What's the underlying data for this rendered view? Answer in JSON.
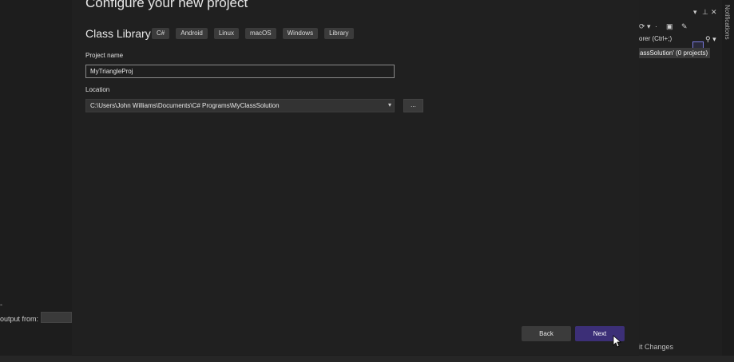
{
  "left_pane": {
    "tick": "-",
    "output_from_label": "output from:"
  },
  "dialog": {
    "title": "Configure your new project",
    "template_name": "Class Library",
    "tags": [
      "C#",
      "Android",
      "Linux",
      "macOS",
      "Windows",
      "Library"
    ],
    "project_name_label": "Project name",
    "project_name_value": "MyTriangleProj",
    "location_label": "Location",
    "location_value": "C:\\Users\\John Williams\\Documents\\C# Programs\\MyClassSolution",
    "browse_label": "...",
    "back_label": "Back",
    "next_label": "Next"
  },
  "right_pane": {
    "search_placeholder": "orer (Ctrl+;)",
    "solution_item": "assSolution' (0 projects)",
    "git_changes": "it Changes",
    "notifications": "Notifications"
  },
  "colors": {
    "accent": "#3c2f77",
    "background": "#202020"
  }
}
